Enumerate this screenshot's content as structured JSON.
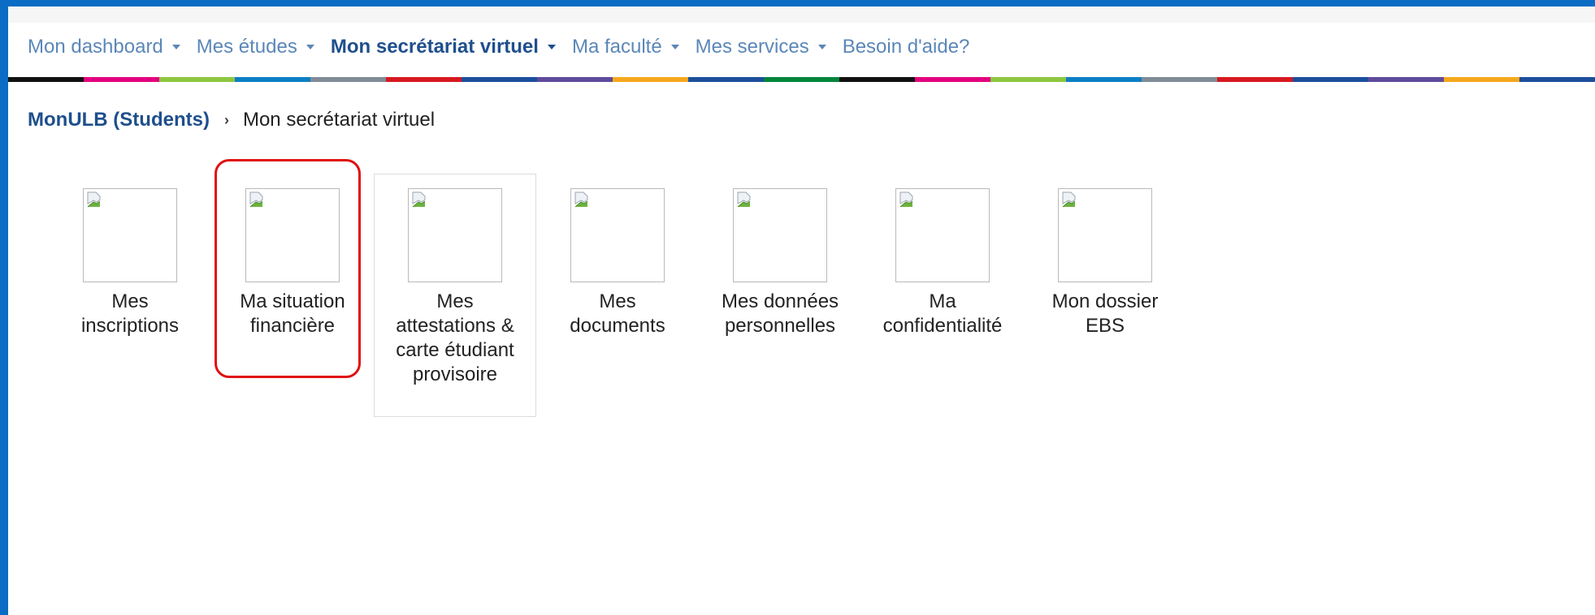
{
  "nav": {
    "items": [
      {
        "label": "Mon dashboard",
        "caret": true,
        "active": false
      },
      {
        "label": "Mes études",
        "caret": true,
        "active": false
      },
      {
        "label": "Mon secrétariat virtuel",
        "caret": true,
        "active": true
      },
      {
        "label": "Ma faculté",
        "caret": true,
        "active": false
      },
      {
        "label": "Mes services",
        "caret": true,
        "active": false
      },
      {
        "label": "Besoin d'aide?",
        "caret": false,
        "active": false
      }
    ]
  },
  "colorbar": [
    "#111111",
    "#e4007f",
    "#8dc63f",
    "#0b7fc4",
    "#7f8c97",
    "#d71920",
    "#1c4f9c",
    "#5e4b9c",
    "#f5a81c",
    "#1c4f9c",
    "#00843d",
    "#111111",
    "#e4007f",
    "#8dc63f",
    "#0b7fc4",
    "#7f8c97",
    "#d71920",
    "#1c4f9c",
    "#5e4b9c",
    "#f5a81c",
    "#1c4f9c"
  ],
  "breadcrumb": {
    "root": "MonULB (Students)",
    "separator": "›",
    "current": "Mon secrétariat virtuel"
  },
  "tiles": [
    {
      "label_line1": "Mes",
      "label_line2": "inscriptions",
      "label_line3": "",
      "label_line4": "",
      "icon": "broken-image-icon"
    },
    {
      "label_line1": "Ma situation",
      "label_line2": "financière",
      "label_line3": "",
      "label_line4": "",
      "icon": "broken-image-icon",
      "highlighted": true
    },
    {
      "label_line1": "Mes",
      "label_line2": "attestations &",
      "label_line3": "carte étudiant",
      "label_line4": "provisoire",
      "icon": "broken-image-icon",
      "hovered": true
    },
    {
      "label_line1": "Mes",
      "label_line2": "documents",
      "label_line3": "",
      "label_line4": "",
      "icon": "broken-image-icon"
    },
    {
      "label_line1": "Mes données",
      "label_line2": "personnelles",
      "label_line3": "",
      "label_line4": "",
      "icon": "broken-image-icon"
    },
    {
      "label_line1": "Ma",
      "label_line2": "confidentialité",
      "label_line3": "",
      "label_line4": "",
      "icon": "broken-image-icon"
    },
    {
      "label_line1": "Mon dossier",
      "label_line2": "EBS",
      "label_line3": "",
      "label_line4": "",
      "icon": "broken-image-icon"
    }
  ],
  "colors": {
    "frame_border": "#0a6cc4",
    "nav_text": "#5b87b8",
    "nav_active": "#1f4f8c",
    "highlight": "#e01010"
  }
}
